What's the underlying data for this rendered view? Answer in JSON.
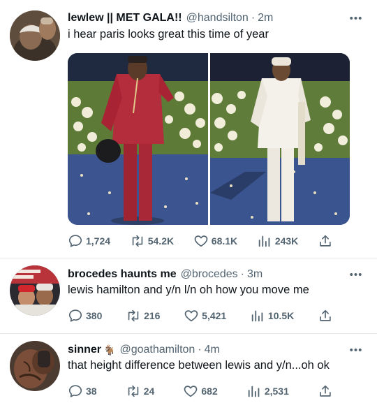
{
  "tweets": [
    {
      "name": "lewlew || MET GALA!!",
      "handle": "@handsilton",
      "time": "2m",
      "text": "i hear paris looks great this time of year",
      "replies": "1,724",
      "retweets": "54.2K",
      "likes": "68.1K",
      "views": "243K"
    },
    {
      "name": "brocedes haunts me",
      "handle": "@brocedes",
      "time": "3m",
      "text": "lewis hamilton and y/n l/n oh how you move me",
      "replies": "380",
      "retweets": "216",
      "likes": "5,421",
      "views": "10.5K"
    },
    {
      "name": "sinner",
      "name_emoji": "🐐",
      "handle": "@goathamilton",
      "time": "4m",
      "text": "that height difference between lewis and y/n...oh ok",
      "replies": "38",
      "retweets": "24",
      "likes": "682",
      "views": "2,531"
    }
  ],
  "separator": "·",
  "colors": {
    "text": "#0f1419",
    "muted": "#536471",
    "divider": "#e6e9ec"
  }
}
